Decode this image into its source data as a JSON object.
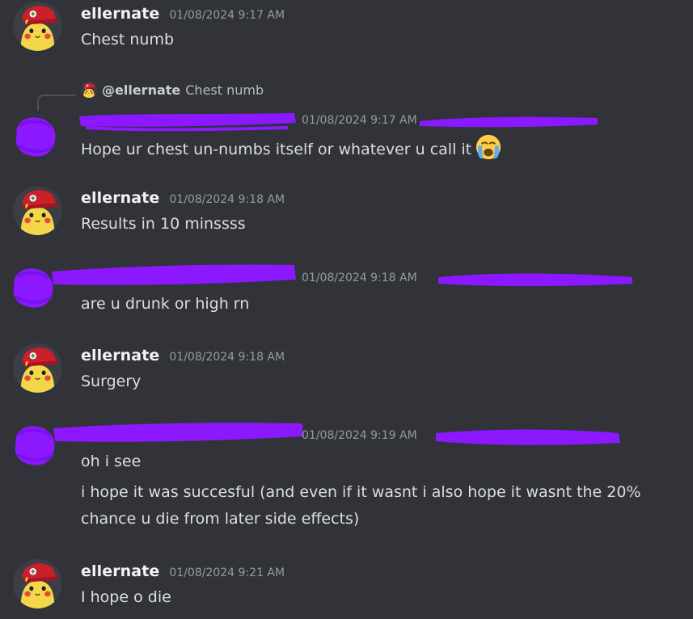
{
  "messages": [
    {
      "author": "ellernate",
      "timestamp": "01/08/2024 9:17 AM",
      "lines": [
        "Chest numb"
      ]
    },
    {
      "reply": {
        "mention": "@ellernate",
        "preview": "Chest numb"
      },
      "timestamp": "01/08/2024 9:17 AM",
      "lines": [
        "Hope ur chest un-numbs itself or whatever u call it"
      ],
      "emoji": "loudly-crying-face"
    },
    {
      "author": "ellernate",
      "timestamp": "01/08/2024 9:18 AM",
      "lines": [
        "Results in 10 minssss"
      ]
    },
    {
      "timestamp": "01/08/2024 9:18 AM",
      "lines": [
        "are u drunk or high rn"
      ]
    },
    {
      "author": "ellernate",
      "timestamp": "01/08/2024 9:18 AM",
      "lines": [
        "Surgery"
      ]
    },
    {
      "timestamp": "01/08/2024 9:19 AM",
      "lines": [
        "oh i see",
        "i hope it was succesful (and even if it wasnt i also hope it wasnt the 20% chance u die from later side effects)"
      ]
    },
    {
      "author": "ellernate",
      "timestamp": "01/08/2024 9:21 AM",
      "lines": [
        "I hope o die"
      ]
    }
  ],
  "colors": {
    "background": "#313338",
    "username": "#f2f3f5",
    "timestamp": "#949ba4",
    "message_text": "#dbdee1",
    "redaction": "#8b18ff"
  },
  "icons": {
    "ellernate_avatar": "pikachu-red-cap-avatar",
    "redacted_avatar": "purple-scribble-avatar"
  }
}
